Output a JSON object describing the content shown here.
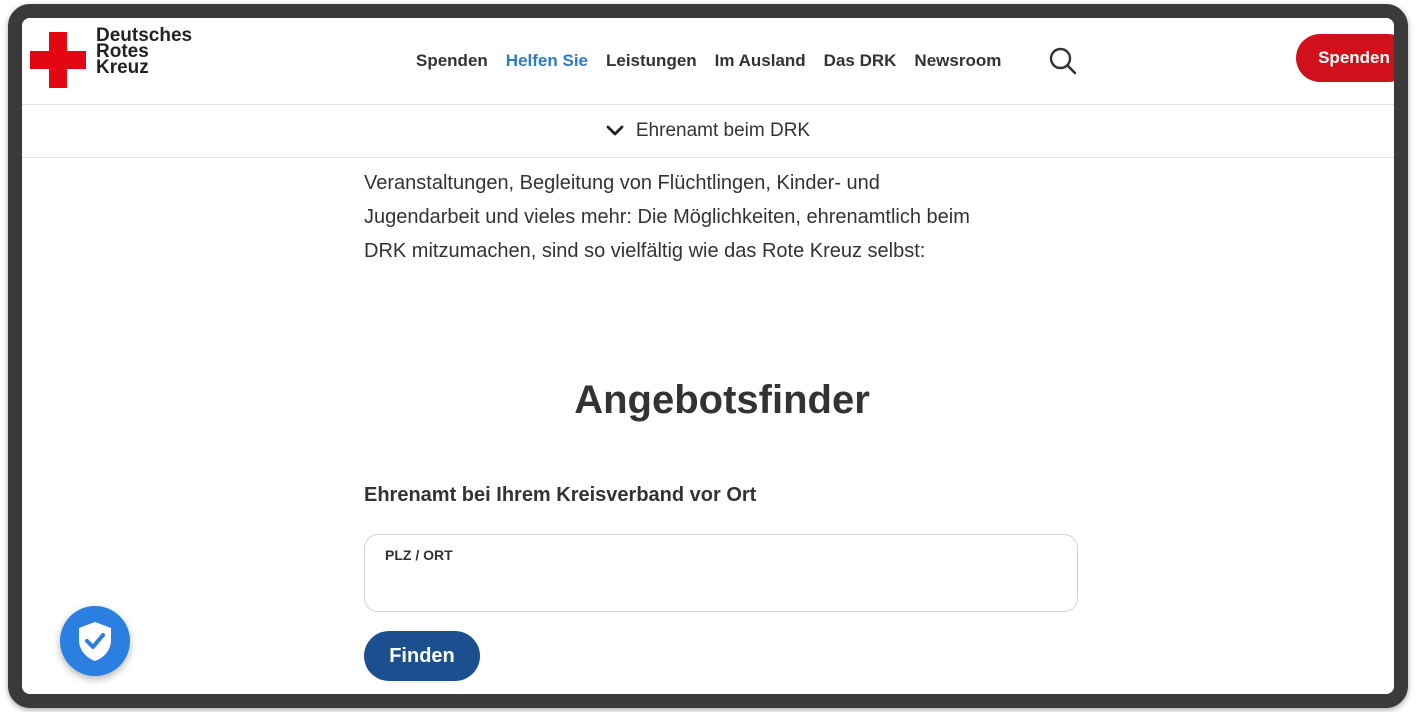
{
  "header": {
    "logo_lines": [
      "Deutsches",
      "Rotes",
      "Kreuz"
    ],
    "nav": [
      {
        "label": "Spenden",
        "active": false
      },
      {
        "label": "Helfen Sie",
        "active": true
      },
      {
        "label": "Leistungen",
        "active": false
      },
      {
        "label": "Im Ausland",
        "active": false
      },
      {
        "label": "Das DRK",
        "active": false
      },
      {
        "label": "Newsroom",
        "active": false
      }
    ],
    "search_icon": "search-icon",
    "donate_label": "Spenden"
  },
  "subnav": {
    "label": "Ehrenamt beim DRK",
    "icon": "chevron-down-icon"
  },
  "main": {
    "intro_lines": [
      "Veranstaltungen, Begleitung von Flüchtlingen, Kinder- und",
      "Jugendarbeit und vieles mehr: Die Möglichkeiten, ehrenamtlich beim",
      "DRK mitzumachen, sind so vielfältig wie das Rote Kreuz selbst:"
    ],
    "finder_title": "Angebotsfinder",
    "finder_subtitle": "Ehrenamt bei Ihrem Kreisverband vor Ort",
    "plz_label": "PLZ / ORT",
    "plz_value": "",
    "find_button": "Finden"
  },
  "privacy_badge": {
    "icon": "shield-check-icon"
  },
  "colors": {
    "brand_red": "#e30613",
    "donate_red": "#d0101a",
    "active_nav": "#2e7bc4",
    "find_button": "#1b4f8f",
    "privacy_badge": "#2a7fe0"
  }
}
